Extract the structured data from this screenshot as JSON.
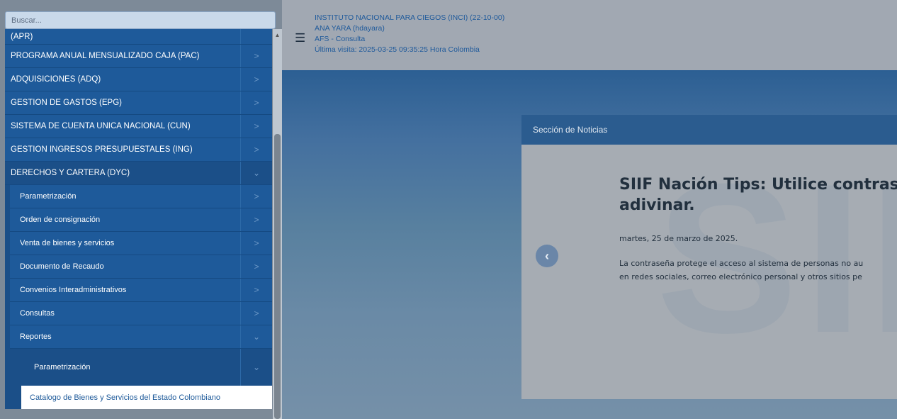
{
  "search": {
    "placeholder": "Buscar..."
  },
  "menu": {
    "items": [
      {
        "label": "(APR)"
      },
      {
        "label": "PROGRAMA ANUAL MENSUALIZADO CAJA (PAC)"
      },
      {
        "label": "ADQUISICIONES (ADQ)"
      },
      {
        "label": "GESTION DE GASTOS (EPG)"
      },
      {
        "label": "SISTEMA DE CUENTA UNICA NACIONAL (CUN)"
      },
      {
        "label": "GESTION INGRESOS PRESUPUESTALES (ING)"
      },
      {
        "label": "DERECHOS Y CARTERA (DYC)"
      }
    ],
    "dyc_sub": [
      {
        "label": "Parametrización"
      },
      {
        "label": "Orden de consignación"
      },
      {
        "label": "Venta de bienes y servicios"
      },
      {
        "label": "Documento de Recaudo"
      },
      {
        "label": "Convenios Interadministrativos"
      },
      {
        "label": "Consultas"
      },
      {
        "label": "Reportes"
      }
    ],
    "reportes_sub": {
      "label": "Parametrización"
    },
    "leaf": {
      "label": "Catalogo de Bienes y Servicios del Estado Colombiano"
    }
  },
  "header": {
    "entity": "INSTITUTO NACIONAL PARA CIEGOS (INCI) (22-10-00)",
    "user": "ANA YARA (hdayara)",
    "role": "AFS - Consulta",
    "last_visit": "Última visita: 2025-03-25 09:35:25 Hora Colombia"
  },
  "news": {
    "section_title": "Sección de Noticias",
    "title_line1": "SIIF Nación Tips: Utilice contraseñ",
    "title_line2": "adivinar.",
    "date": "martes, 25 de marzo de 2025.",
    "text_line1": "La contraseña protege el acceso al sistema de personas no au",
    "text_line2": "en redes sociales, correo electrónico personal y otros sitios pe",
    "watermark": "SII"
  },
  "icons": {
    "chevron_right": "chevron-right-icon",
    "chevron_down": "chevron-down-icon",
    "hamburger": "hamburger-menu-icon",
    "prev": "chevron-left-circle-icon"
  }
}
